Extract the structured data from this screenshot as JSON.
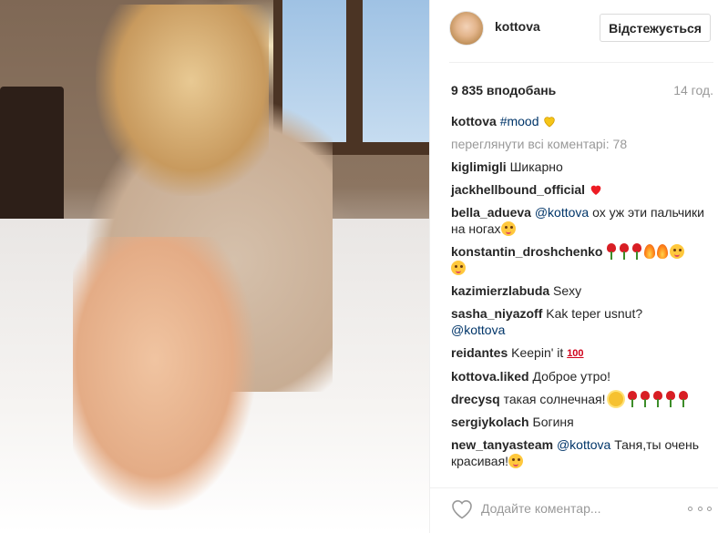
{
  "post": {
    "username": "kottova",
    "follow_label": "Відстежується",
    "likes": "9 835 вподобань",
    "time": "14 год."
  },
  "caption": {
    "author": "kottova",
    "hashtag": "#mood"
  },
  "view_all_comments": "переглянути всі коментарі: 78",
  "comments": [
    {
      "author": "kiglimigli",
      "text": "Шикарно"
    },
    {
      "author": "jackhellbound_official",
      "text": ""
    },
    {
      "author": "bella_adueva",
      "mention": "@kottova",
      "text": " ох уж эти пальчики на ногах"
    },
    {
      "author": "konstantin_droshchenko",
      "text": ""
    },
    {
      "author": "kazimierzlabuda",
      "text": "Sexy"
    },
    {
      "author": "sasha_niyazoff",
      "text": "Kak teper usnut?",
      "mention": "@kottova"
    },
    {
      "author": "reidantes",
      "text": "Keepin' it"
    },
    {
      "author": "kottova.liked",
      "text": "Доброе утро!"
    },
    {
      "author": "drecysq",
      "text": "такая солнечная!"
    },
    {
      "author": "sergiykolach",
      "text": "Богиня"
    },
    {
      "author": "new_tanyasteam",
      "mention": "@kottova",
      "text": " Таня,ты очень красивая!"
    }
  ],
  "emoji_100_label": "100",
  "add_comment": {
    "placeholder": "Додайте коментар..."
  },
  "colors": {
    "text": "#262626",
    "muted": "#999999",
    "link": "#003569",
    "heart_red": "#ed1c24",
    "heart_yellow": "#f5c518"
  },
  "icons": {
    "like": "heart-outline-icon",
    "more": "more-options-icon"
  }
}
